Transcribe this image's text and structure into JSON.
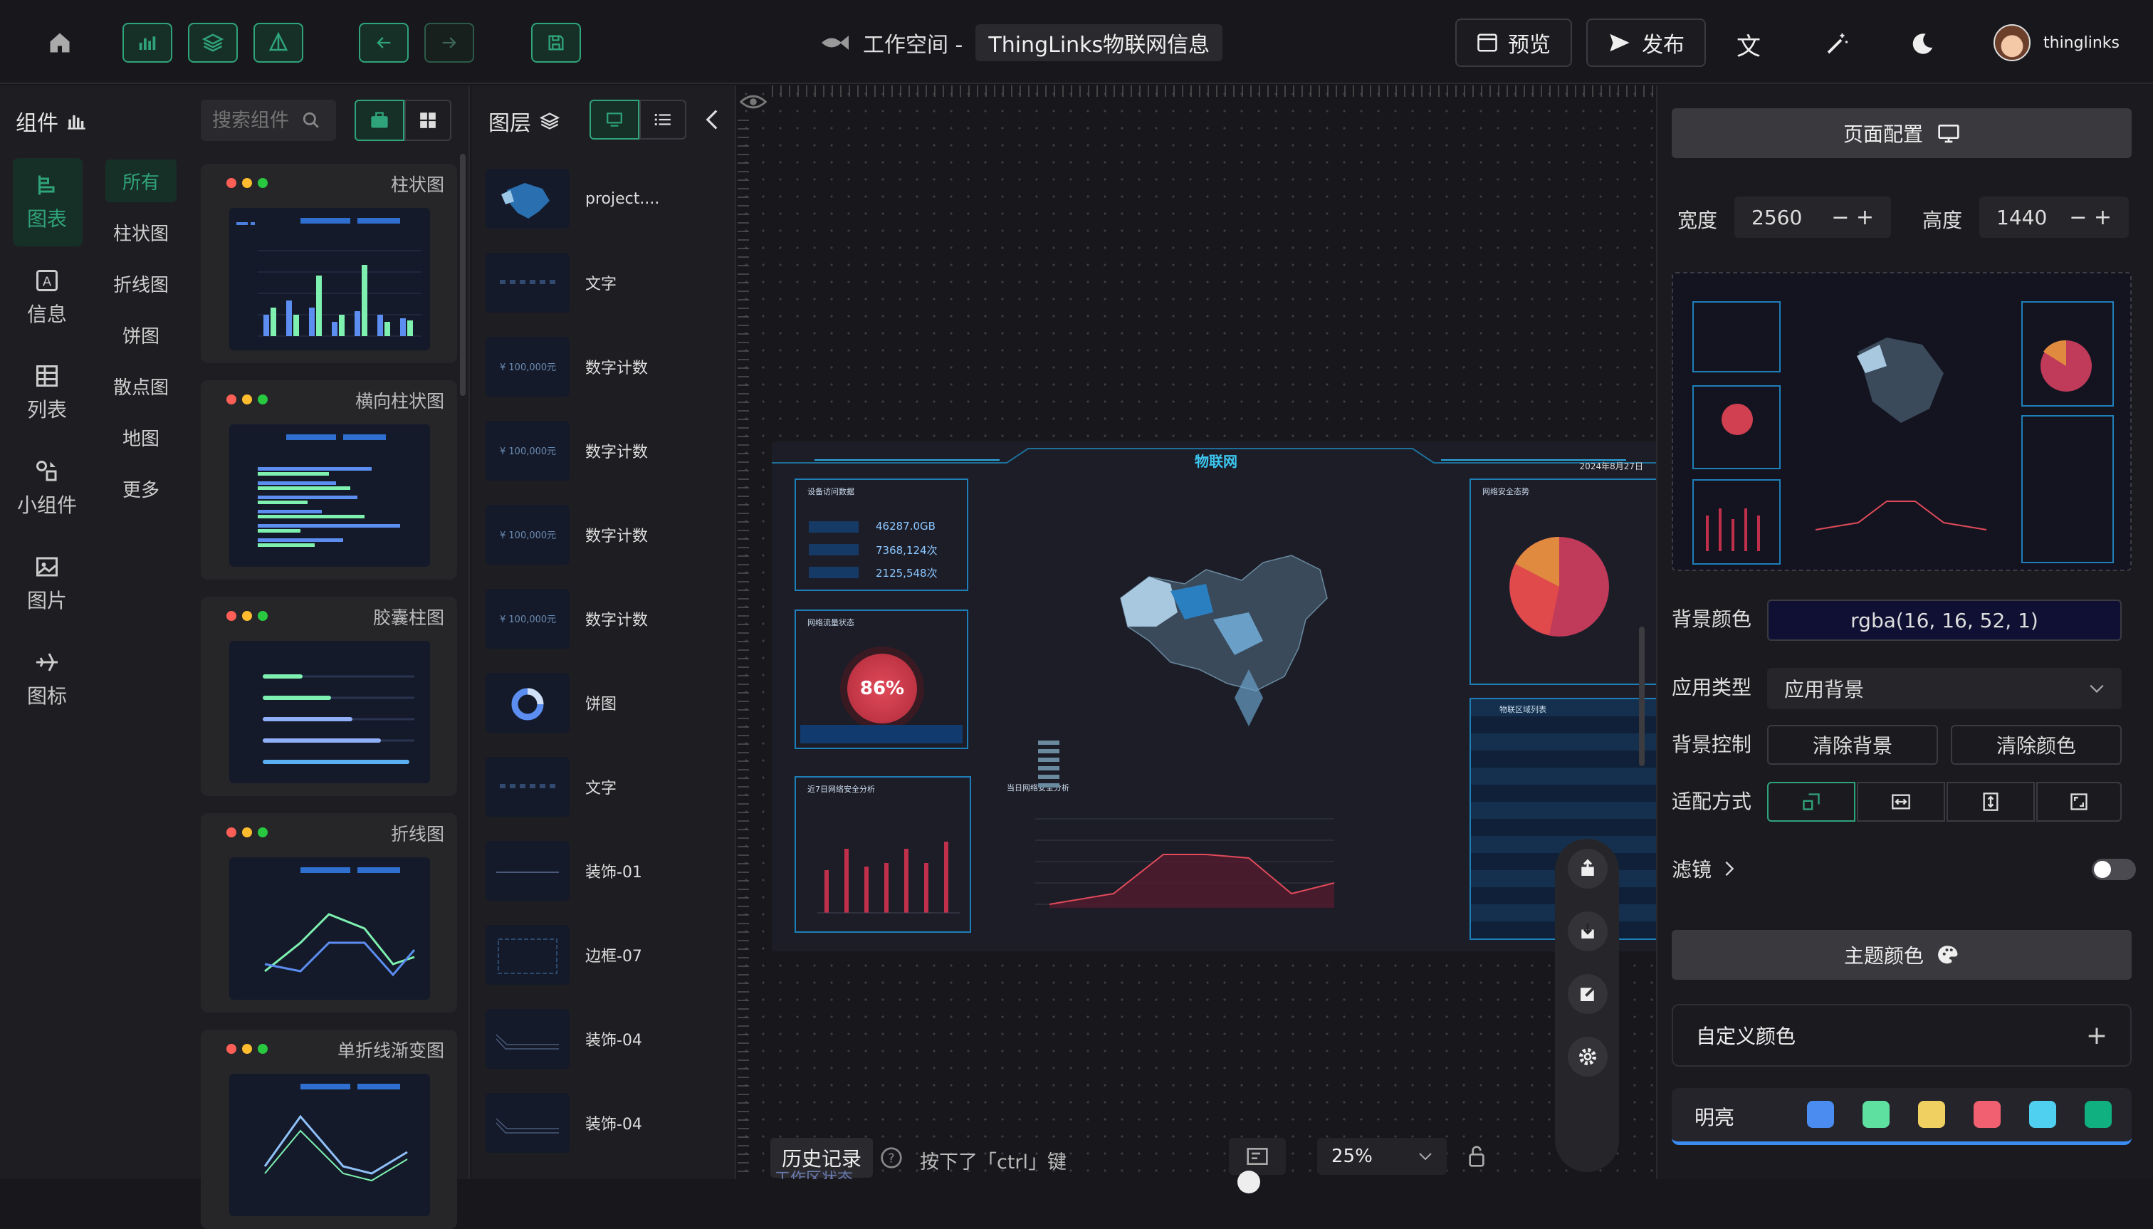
{
  "header": {
    "workspace_prefix": "工作空间 -",
    "project_name": "ThingLinks物联网信息",
    "preview": "预览",
    "publish": "发布",
    "username": "thinglinks"
  },
  "components": {
    "title": "组件",
    "search_placeholder": "搜索组件",
    "categories": [
      {
        "label": "图表",
        "icon": "chart-icon"
      },
      {
        "label": "信息",
        "icon": "info-icon"
      },
      {
        "label": "列表",
        "icon": "table-icon"
      },
      {
        "label": "小组件",
        "icon": "widget-icon"
      },
      {
        "label": "图片",
        "icon": "image-icon"
      },
      {
        "label": "图标",
        "icon": "plane-icon"
      }
    ],
    "subcategories": [
      "所有",
      "柱状图",
      "折线图",
      "饼图",
      "散点图",
      "地图",
      "更多"
    ],
    "cards": [
      "柱状图",
      "横向柱状图",
      "胶囊柱图",
      "折线图",
      "单折线渐变图"
    ]
  },
  "layers": {
    "title": "图层",
    "items": [
      "project....",
      "文字",
      "数字计数",
      "数字计数",
      "数字计数",
      "数字计数",
      "饼图",
      "文字",
      "装饰-01",
      "边框-07",
      "装饰-04",
      "装饰-04"
    ],
    "counter_text": "¥ 100,000元"
  },
  "canvas": {
    "history": "历史记录",
    "hint": "按下了「ctrl」键",
    "zoom": "25%",
    "status": "工作区状态",
    "dash": {
      "title": "物联网",
      "date": "2024年8月27日",
      "p1_title": "设备访问数据",
      "v1": "46287.0GB",
      "v2": "7368,124次",
      "v3": "2125,548次",
      "p2_title": "网络流量状态",
      "percent": "86%",
      "p3_title": "近7日网络安全分析",
      "p4_title": "当日网络安全分析",
      "p5_title": "网络安全态势",
      "p6_title": "物联区域列表"
    }
  },
  "config": {
    "page_config": "页面配置",
    "width_label": "宽度",
    "width": "2560",
    "height_label": "高度",
    "height": "1440",
    "bg_color_label": "背景颜色",
    "bg_color": "rgba(16, 16, 52, 1)",
    "app_type_label": "应用类型",
    "app_type": "应用背景",
    "bg_control_label": "背景控制",
    "clear_bg": "清除背景",
    "clear_color": "清除颜色",
    "fit_label": "适配方式",
    "filter_label": "滤镜",
    "theme_color": "主题颜色",
    "custom_color": "自定义颜色",
    "bright": "明亮",
    "swatches": [
      "#4a8cf0",
      "#5ee0a0",
      "#f0d060",
      "#f06070",
      "#50d0f0",
      "#10b080"
    ]
  }
}
